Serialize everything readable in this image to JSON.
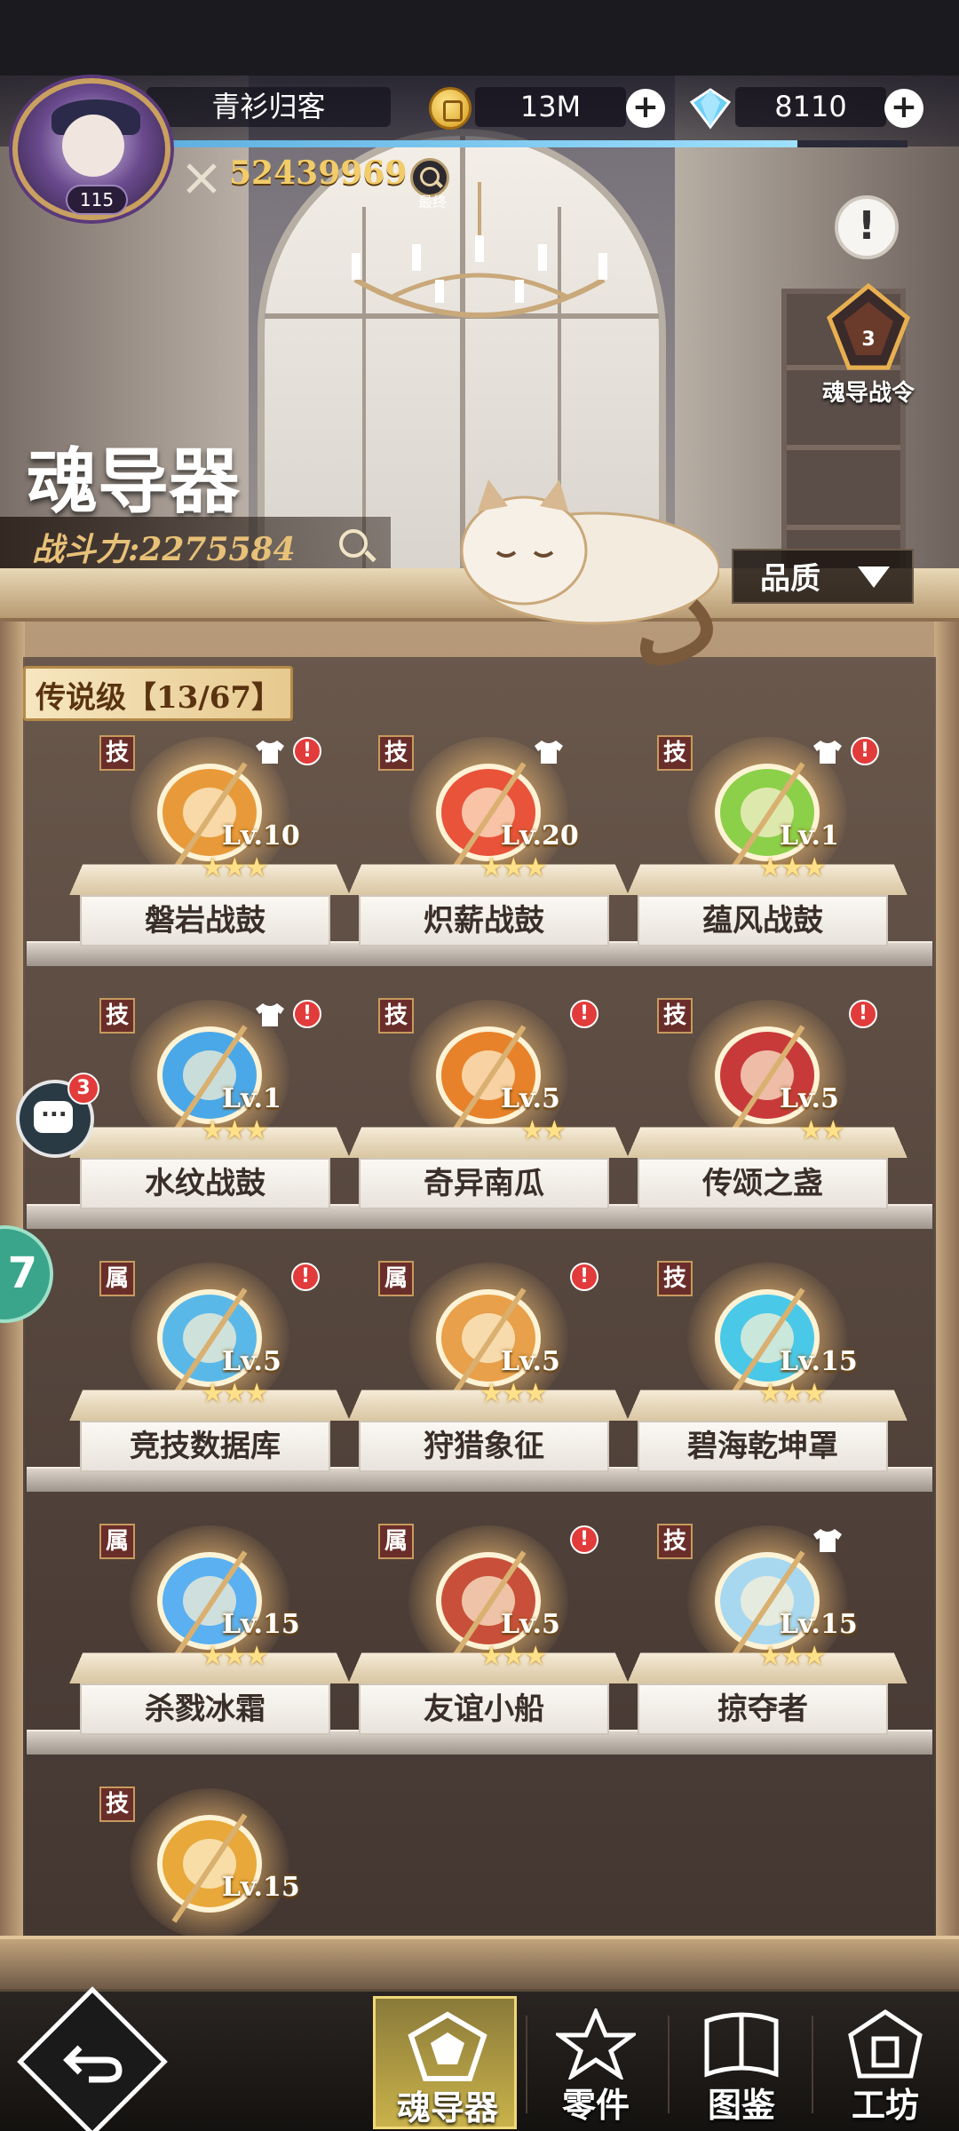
{
  "hud": {
    "player_name": "青衫归客",
    "player_level": "115",
    "gold": "13M",
    "gems": "8110",
    "power": "52439969",
    "final_label": "最终",
    "exp_fraction": 0.85
  },
  "battle_pass": {
    "level": "3",
    "label": "魂导战令"
  },
  "notice_symbol": "!",
  "page": {
    "title": "魂导器",
    "combat_power": "战斗力:2275584",
    "quality_filter": "品质"
  },
  "category": {
    "label": "传说级【13/67】"
  },
  "items": [
    {
      "name": "磐岩战鼓",
      "tag": "技",
      "level": "Lv.10",
      "stars": 3,
      "shirt": true,
      "alert": true,
      "icon": "orange-drum-icon",
      "color": "#e89a3a"
    },
    {
      "name": "炽薪战鼓",
      "tag": "技",
      "level": "Lv.20",
      "stars": 3,
      "shirt": true,
      "alert": false,
      "icon": "fire-drum-icon",
      "color": "#e8533a"
    },
    {
      "name": "蕴风战鼓",
      "tag": "技",
      "level": "Lv.1",
      "stars": 3,
      "shirt": true,
      "alert": true,
      "icon": "wind-drum-icon",
      "color": "#8cd04a"
    },
    {
      "name": "水纹战鼓",
      "tag": "技",
      "level": "Lv.1",
      "stars": 3,
      "shirt": true,
      "alert": true,
      "icon": "water-drum-icon",
      "color": "#4aa8e8"
    },
    {
      "name": "奇异南瓜",
      "tag": "技",
      "level": "Lv.5",
      "stars": 2,
      "shirt": false,
      "alert": true,
      "icon": "pumpkin-icon",
      "color": "#e8822a"
    },
    {
      "name": "传颂之盏",
      "tag": "技",
      "level": "Lv.5",
      "stars": 2,
      "shirt": false,
      "alert": true,
      "icon": "chalice-icon",
      "color": "#c83a3a"
    },
    {
      "name": "竞技数据库",
      "tag": "属",
      "level": "Lv.5",
      "stars": 3,
      "shirt": false,
      "alert": true,
      "icon": "data-cylinder-icon",
      "color": "#5ab8e8"
    },
    {
      "name": "狩猎象征",
      "tag": "属",
      "level": "Lv.5",
      "stars": 3,
      "shirt": false,
      "alert": true,
      "icon": "fox-mask-icon",
      "color": "#e8a04a"
    },
    {
      "name": "碧海乾坤罩",
      "tag": "技",
      "level": "Lv.15",
      "stars": 3,
      "shirt": false,
      "alert": false,
      "icon": "crystal-pyramid-icon",
      "color": "#4ac8e8"
    },
    {
      "name": "杀戮冰霜",
      "tag": "属",
      "level": "Lv.15",
      "stars": 3,
      "shirt": false,
      "alert": false,
      "icon": "ice-drop-icon",
      "color": "#5ab0f0"
    },
    {
      "name": "友谊小船",
      "tag": "属",
      "level": "Lv.5",
      "stars": 3,
      "shirt": false,
      "alert": true,
      "icon": "boat-icon",
      "color": "#c8503a"
    },
    {
      "name": "掠夺者",
      "tag": "技",
      "level": "Lv.15",
      "stars": 3,
      "shirt": true,
      "alert": false,
      "icon": "ice-cube-icon",
      "color": "#a8d8f0"
    },
    {
      "name": "",
      "tag": "技",
      "level": "Lv.15",
      "stars": 0,
      "shirt": false,
      "alert": false,
      "icon": "golden-pyramid-icon",
      "color": "#e8a83a"
    }
  ],
  "side": {
    "chat_count": "3",
    "float_char": "7"
  },
  "nav": {
    "tabs": [
      {
        "label": "魂导器",
        "active": true
      },
      {
        "label": "零件",
        "active": false
      },
      {
        "label": "图鉴",
        "active": false
      },
      {
        "label": "工坊",
        "active": false
      }
    ]
  }
}
